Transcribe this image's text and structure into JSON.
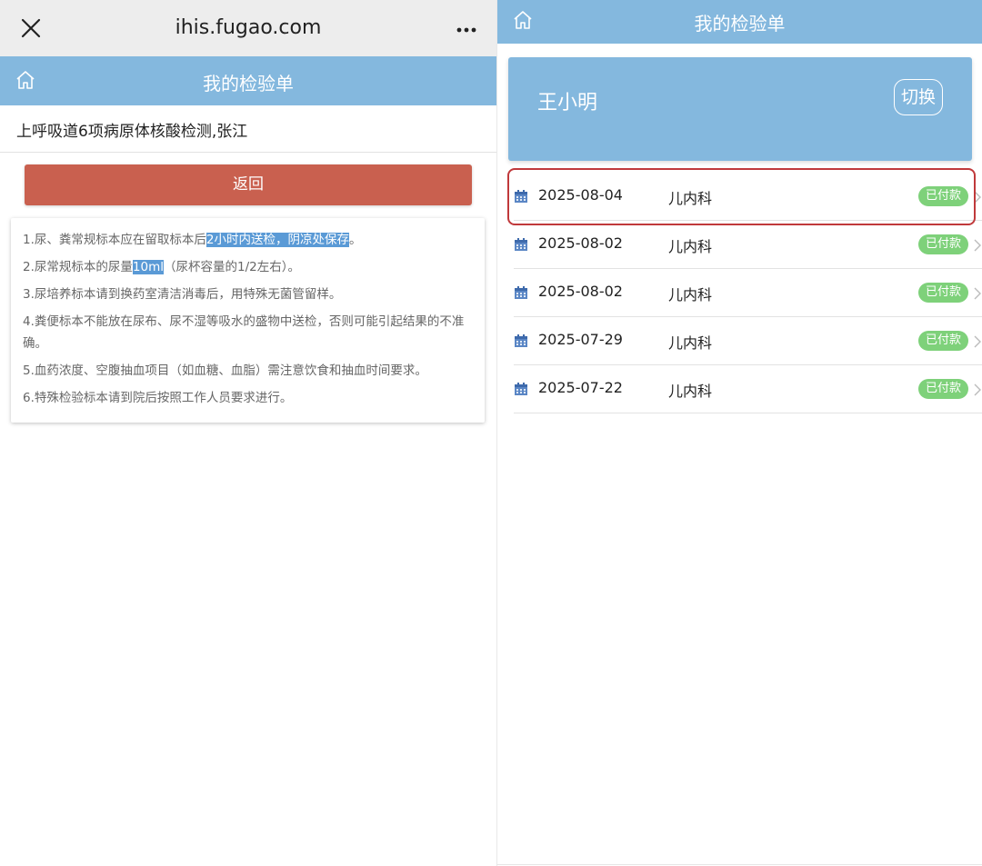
{
  "left": {
    "browser": {
      "url": "ihis.fugao.com",
      "close_icon": "close-icon",
      "more_icon": "more-icon"
    },
    "header": {
      "title": "我的检验单",
      "home_icon": "home-icon"
    },
    "subtitle": "上呼吸道6项病原体核酸检测,张江",
    "back_button": "返回",
    "notes": [
      {
        "pre": "1.尿、粪常规标本应在留取标本后",
        "hl": "2小时内送检，阴凉处保存",
        "post": "。"
      },
      {
        "pre": "2.尿常规标本的尿量",
        "hl": "10ml",
        "post": "（尿杯容量的1/2左右）。"
      },
      {
        "pre": "3.尿培养标本请到换药室清洁消毒后，用特殊无菌管留样。",
        "hl": "",
        "post": ""
      },
      {
        "pre": "4.粪便标本不能放在尿布、尿不湿等吸水的盛物中送检，否则可能引起结果的不准确。",
        "hl": "",
        "post": ""
      },
      {
        "pre": "5.血药浓度、空腹抽血项目（如血糖、血脂）需注意饮食和抽血时间要求。",
        "hl": "",
        "post": ""
      },
      {
        "pre": "6.特殊检验标本请到院后按照工作人员要求进行。",
        "hl": "",
        "post": ""
      }
    ],
    "highlight_color": "#5a9ad6"
  },
  "right": {
    "header": {
      "title": "我的检验单",
      "home_icon": "home-icon"
    },
    "patient": {
      "name": "王小明",
      "switch_label": "切换"
    },
    "records": [
      {
        "date": "2025-08-04",
        "dept": "儿内科",
        "status": "已付款"
      },
      {
        "date": "2025-08-02",
        "dept": "儿内科",
        "status": "已付款"
      },
      {
        "date": "2025-08-02",
        "dept": "儿内科",
        "status": "已付款"
      },
      {
        "date": "2025-07-29",
        "dept": "儿内科",
        "status": "已付款"
      },
      {
        "date": "2025-07-22",
        "dept": "儿内科",
        "status": "已付款"
      }
    ],
    "calendar_icon": "calendar-icon",
    "chevron_icon": "chevron-right-icon"
  },
  "colors": {
    "header_blue": "#84b8de",
    "back_red": "#c9604f",
    "paid_green": "#7ed17a",
    "highlight_red": "#c0393b"
  }
}
